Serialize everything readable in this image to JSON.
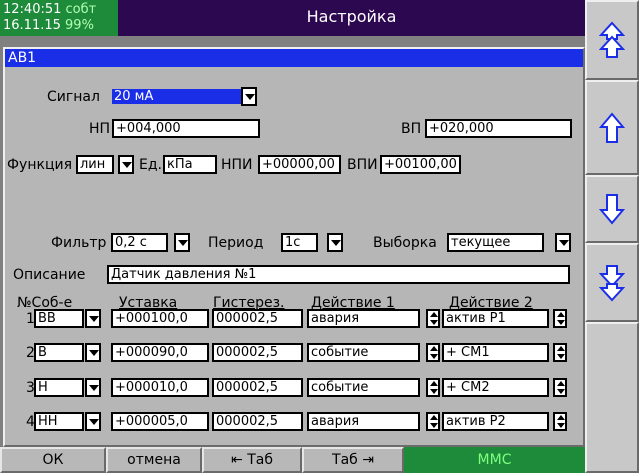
{
  "topbar": {
    "time": "12:40:51",
    "mode": "собт",
    "date": "16.11.15",
    "battery": "99%",
    "title": "Настройка"
  },
  "panel": {
    "header": "АВ1",
    "signal": {
      "label": "Сигнал",
      "value": "20 мА"
    },
    "np": {
      "label": "НП",
      "value": "+004,000"
    },
    "vp": {
      "label": "ВП",
      "value": "+020,000"
    },
    "function": {
      "label": "Функция",
      "value": "лин"
    },
    "unit": {
      "label": "Ед.",
      "value": "кПа"
    },
    "npi": {
      "label": "НПИ",
      "value": "+00000,00"
    },
    "vpi": {
      "label": "ВПИ",
      "value": "+00100,00"
    },
    "filter": {
      "label": "Фильтр",
      "value": "0,2 с"
    },
    "period": {
      "label": "Период",
      "value": "1с"
    },
    "sample": {
      "label": "Выборка",
      "value": "текущее"
    },
    "description": {
      "label": "Описание",
      "value": "Датчик давления №1"
    },
    "table": {
      "headers": {
        "num_event": "№Соб-е",
        "setpoint": "Уставка",
        "hysteresis": "Гистерез.",
        "action1": "Действие 1",
        "action2": "Действие 2"
      },
      "rows": [
        {
          "num": "1",
          "event": "ВВ",
          "setpoint": "+000100,0",
          "hysteresis": "000002,5",
          "action1": "авария",
          "action2": "актив Р1"
        },
        {
          "num": "2",
          "event": "В",
          "setpoint": "+000090,0",
          "hysteresis": "000002,5",
          "action1": "событие",
          "action2": "+ СМ1"
        },
        {
          "num": "3",
          "event": "Н",
          "setpoint": "+000010,0",
          "hysteresis": "000002,5",
          "action1": "событие",
          "action2": "+ СМ2"
        },
        {
          "num": "4",
          "event": "НН",
          "setpoint": "+000005,0",
          "hysteresis": "000002,5",
          "action1": "авария",
          "action2": "актив Р2"
        }
      ]
    }
  },
  "right_buttons": [
    "double-up-arrow-icon",
    "up-arrow-icon",
    "down-arrow-icon",
    "double-down-arrow-icon"
  ],
  "bottombar": {
    "ok": "ОК",
    "cancel": "отмена",
    "tab_back": "⇤ Таб",
    "tab_forward": "Таб ⇥",
    "mmc": "ММС"
  },
  "colors": {
    "topbar_bg": "#2c0850",
    "clock_bg": "#1e8b3b",
    "selection_blue": "#1a2ee8",
    "panel_bg": "#b6b6b6",
    "mmc_text": "#7dff7d"
  }
}
